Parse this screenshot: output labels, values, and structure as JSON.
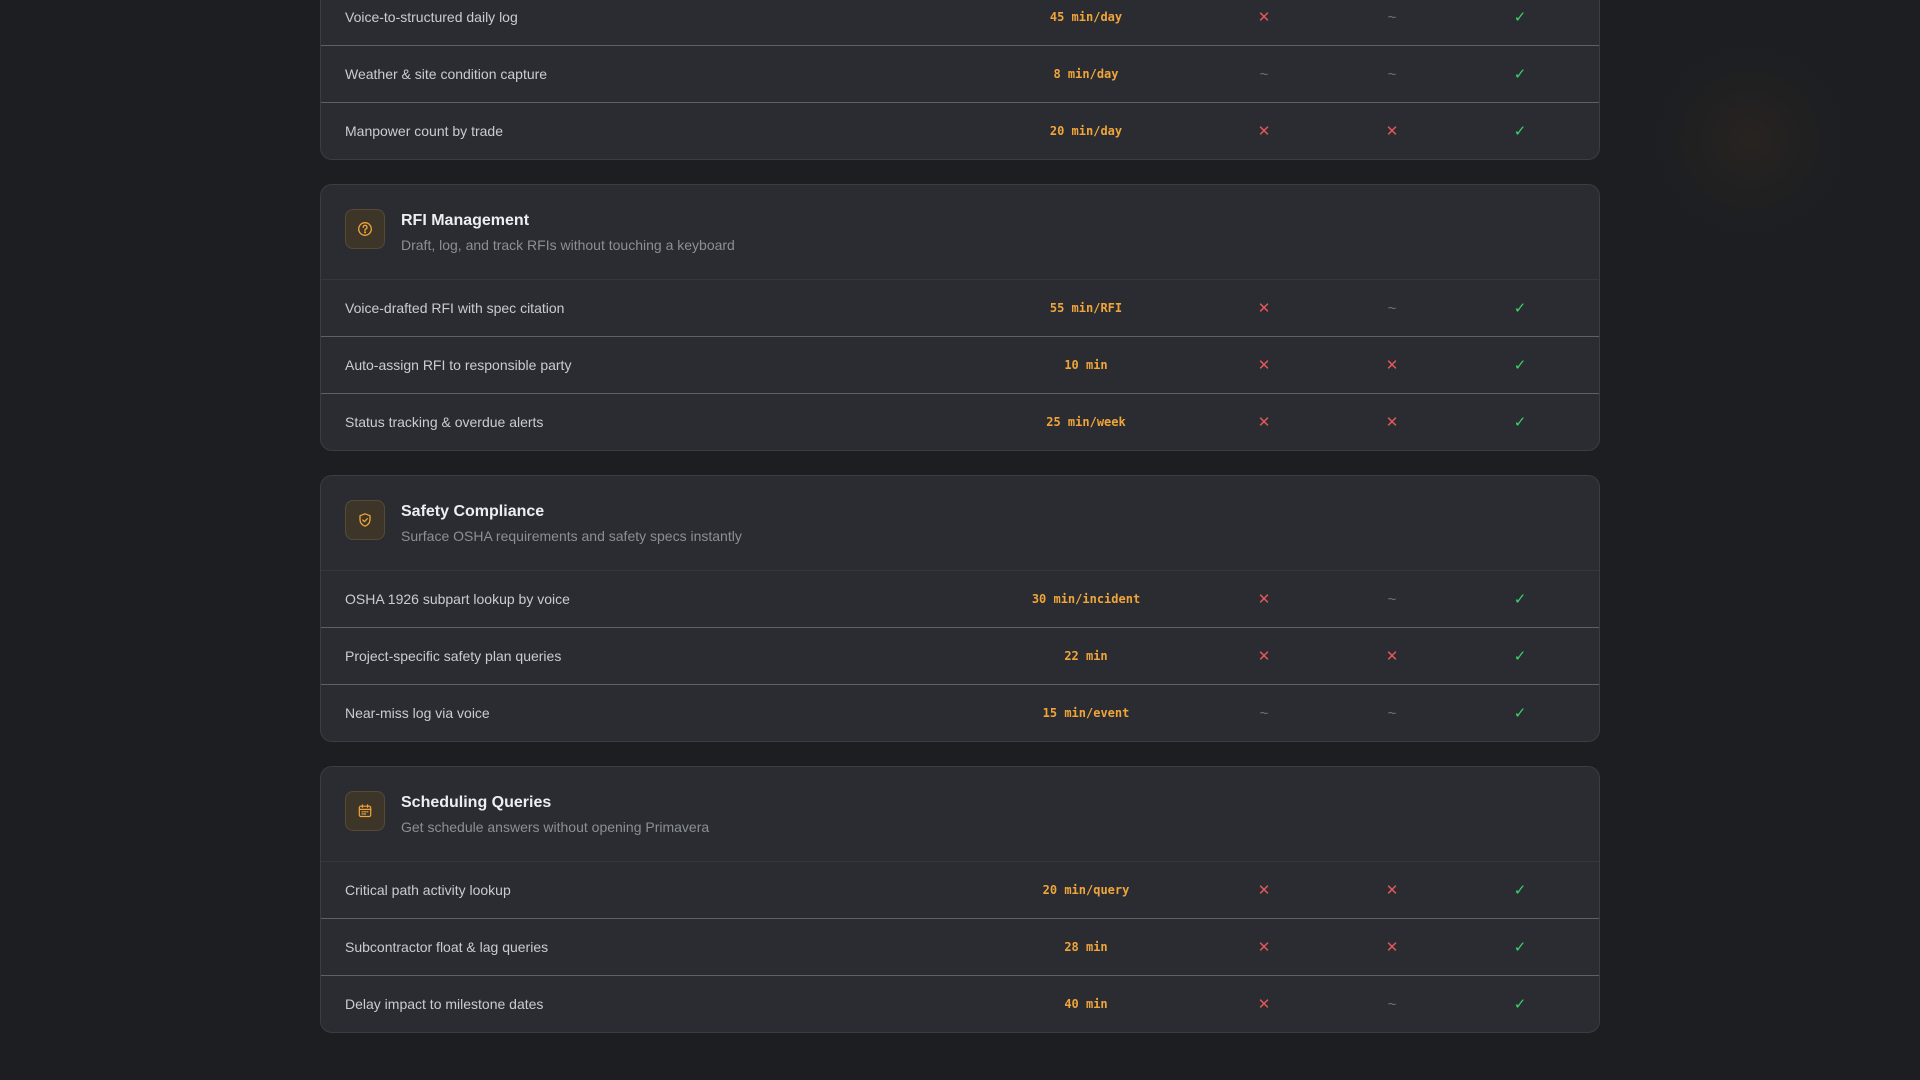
{
  "colors": {
    "background": "#1c1e22",
    "card": "#2a2c31",
    "accent": "#f0a53a",
    "cross": "#e2575a",
    "check": "#3fcf6a",
    "partial": "#6e7279"
  },
  "marks": {
    "no": "✕",
    "partial": "~",
    "yes": "✓"
  },
  "sections": [
    {
      "title": "",
      "subtitle": "",
      "icon": "",
      "rows": [
        {
          "feature": "Voice-to-structured daily log",
          "time": "45 min/day",
          "c1": "✕",
          "c2": "~",
          "c3": "✓"
        },
        {
          "feature": "Weather & site condition capture",
          "time": "8 min/day",
          "c1": "~",
          "c2": "~",
          "c3": "✓"
        },
        {
          "feature": "Manpower count by trade",
          "time": "20 min/day",
          "c1": "✕",
          "c2": "✕",
          "c3": "✓"
        }
      ]
    },
    {
      "title": "RFI Management",
      "subtitle": "Draft, log, and track RFIs without touching a keyboard",
      "icon": "question-circle-icon",
      "rows": [
        {
          "feature": "Voice-drafted RFI with spec citation",
          "time": "55 min/RFI",
          "c1": "✕",
          "c2": "~",
          "c3": "✓"
        },
        {
          "feature": "Auto-assign RFI to responsible party",
          "time": "10 min",
          "c1": "✕",
          "c2": "✕",
          "c3": "✓"
        },
        {
          "feature": "Status tracking & overdue alerts",
          "time": "25 min/week",
          "c1": "✕",
          "c2": "✕",
          "c3": "✓"
        }
      ]
    },
    {
      "title": "Safety Compliance",
      "subtitle": "Surface OSHA requirements and safety specs instantly",
      "icon": "shield-check-icon",
      "rows": [
        {
          "feature": "OSHA 1926 subpart lookup by voice",
          "time": "30 min/incident",
          "c1": "✕",
          "c2": "~",
          "c3": "✓"
        },
        {
          "feature": "Project-specific safety plan queries",
          "time": "22 min",
          "c1": "✕",
          "c2": "✕",
          "c3": "✓"
        },
        {
          "feature": "Near-miss log via voice",
          "time": "15 min/event",
          "c1": "~",
          "c2": "~",
          "c3": "✓"
        }
      ]
    },
    {
      "title": "Scheduling Queries",
      "subtitle": "Get schedule answers without opening Primavera",
      "icon": "calendar-icon",
      "rows": [
        {
          "feature": "Critical path activity lookup",
          "time": "20 min/query",
          "c1": "✕",
          "c2": "✕",
          "c3": "✓"
        },
        {
          "feature": "Subcontractor float & lag queries",
          "time": "28 min",
          "c1": "✕",
          "c2": "✕",
          "c3": "✓"
        },
        {
          "feature": "Delay impact to milestone dates",
          "time": "40 min",
          "c1": "✕",
          "c2": "~",
          "c3": "✓"
        }
      ]
    }
  ]
}
